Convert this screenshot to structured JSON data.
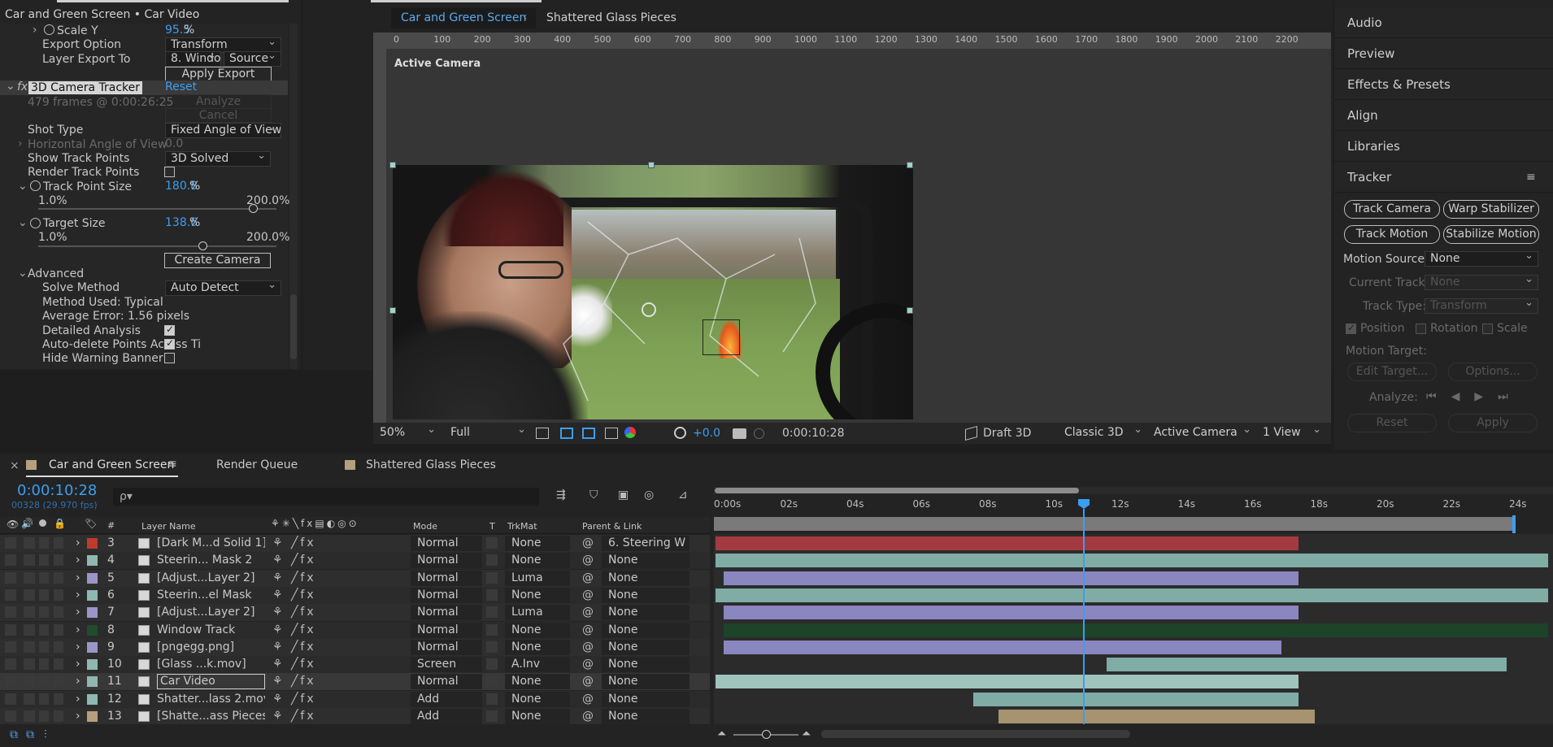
{
  "effect_panel": {
    "title": "Car and Green Screen • Car Video",
    "scale_y_label": "Scale Y",
    "scale_y_value": "95.5",
    "pct": "%",
    "export_option_label": "Export Option",
    "export_option_value": "Transform",
    "layer_export_label": "Layer Export To",
    "layer_export_value": "8. Windo",
    "layer_export_source": "Source",
    "apply_export": "Apply Export",
    "effect_name": "3D Camera Tracker",
    "reset": "Reset",
    "frames_info": "479 frames @ 0:00:26:25",
    "analyze": "Analyze",
    "cancel": "Cancel",
    "shot_type_label": "Shot Type",
    "shot_type_value": "Fixed Angle of View",
    "hav_label": "Horizontal Angle of View",
    "hav_value": "0.0",
    "show_track_label": "Show Track Points",
    "show_track_value": "3D Solved",
    "render_track_label": "Render Track Points",
    "track_size_label": "Track Point Size",
    "track_size_value": "180.8",
    "min1": "1.0%",
    "max1": "200.0%",
    "target_size_label": "Target Size",
    "target_size_value": "138.6",
    "min2": "1.0%",
    "max2": "200.0%",
    "track_size_level": 0.9,
    "target_size_level": 0.69,
    "create_camera": "Create Camera",
    "advanced": "Advanced",
    "solve_method_label": "Solve Method",
    "solve_method_value": "Auto Detect",
    "method_used": "Method Used: Typical",
    "avg_error": "Average Error: 1.56 pixels",
    "detailed": "Detailed Analysis",
    "auto_delete": "Auto-delete Points Across Ti",
    "hide_warning": "Hide Warning Banner"
  },
  "viewer": {
    "tab1": "Car and Green Screen",
    "tab2": "Shattered Glass Pieces",
    "ruler": [
      "0",
      "100",
      "200",
      "300",
      "400",
      "500",
      "600",
      "700",
      "800",
      "900",
      "1000",
      "1100",
      "1200",
      "1300",
      "1400",
      "1500",
      "1600",
      "1700",
      "1800",
      "1900",
      "2000",
      "2100",
      "2200"
    ],
    "active_camera": "Active Camera",
    "zoom": "50%",
    "resolution": "Full",
    "exposure": "+0.0",
    "timecode": "0:00:10:28",
    "draft3d": "Draft 3D",
    "renderer": "Classic 3D",
    "camera": "Active Camera",
    "views": "1 View"
  },
  "right_panel": {
    "tabs": [
      "Audio",
      "Preview",
      "Effects & Presets",
      "Align",
      "Libraries"
    ],
    "tracker_title": "Tracker",
    "track_camera": "Track Camera",
    "warp_stabilizer": "Warp Stabilizer",
    "track_motion": "Track Motion",
    "stabilize_motion": "Stabilize Motion",
    "motion_source_label": "Motion Source:",
    "motion_source_value": "None",
    "current_track_label": "Current Track:",
    "current_track_value": "None",
    "track_type_label": "Track Type:",
    "track_type_value": "Transform",
    "position": "Position",
    "rotation": "Rotation",
    "scale": "Scale",
    "motion_target_label": "Motion Target:",
    "edit_target": "Edit Target...",
    "options": "Options...",
    "analyze": "Analyze:",
    "reset": "Reset",
    "apply": "Apply"
  },
  "timeline": {
    "tab1": "Car and Green Screen",
    "tab2": "Render Queue",
    "tab3": "Shattered Glass Pieces",
    "timecode": "0:00:10:28",
    "fps": "00328 (29.970 fps)",
    "search_placeholder": "ρ▾",
    "col_layer": "Layer Name",
    "col_mode": "Mode",
    "col_t": "T",
    "col_trkmat": "TrkMat",
    "col_parent": "Parent & Link",
    "ruler": [
      "0:00s",
      "02s",
      "04s",
      "06s",
      "08s",
      "10s",
      "12s",
      "14s",
      "16s",
      "18s",
      "20s",
      "22s",
      "24s"
    ],
    "layers": [
      {
        "num": "3",
        "name": "[Dark M...d Solid 1]",
        "mode": "Normal",
        "trk": "None",
        "parent": "6. Steering W",
        "color": "#c0392b",
        "bar": "#a33a3f",
        "bs": 0,
        "be": 0.7
      },
      {
        "num": "4",
        "name": "Steerin... Mask 2",
        "mode": "Normal",
        "trk": "None",
        "parent": "None",
        "color": "#8fb8b0",
        "bar": "#7fada6",
        "bs": 0,
        "be": 1
      },
      {
        "num": "5",
        "name": "[Adjust...Layer 2]",
        "mode": "Normal",
        "trk": "Luma",
        "parent": "None",
        "color": "#9b96c8",
        "bar": "#8a86bf",
        "bs": 0.01,
        "be": 0.7
      },
      {
        "num": "6",
        "name": "Steerin...el Mask",
        "mode": "Normal",
        "trk": "None",
        "parent": "None",
        "color": "#8fb8b0",
        "bar": "#7fada6",
        "bs": 0,
        "be": 1
      },
      {
        "num": "7",
        "name": "[Adjust...Layer 2]",
        "mode": "Normal",
        "trk": "Luma",
        "parent": "None",
        "color": "#9b96c8",
        "bar": "#8a86bf",
        "bs": 0.01,
        "be": 0.7
      },
      {
        "num": "8",
        "name": "Window Track",
        "mode": "Normal",
        "trk": "None",
        "parent": "None",
        "color": "#1f4d2b",
        "bar": "#1d4328",
        "bs": 0.01,
        "be": 1
      },
      {
        "num": "9",
        "name": "[pngegg.png]",
        "mode": "Normal",
        "trk": "None",
        "parent": "None",
        "color": "#9b96c8",
        "bar": "#8a86bf",
        "bs": 0.01,
        "be": 0.68
      },
      {
        "num": "10",
        "name": "[Glass ...k.mov]",
        "mode": "Screen",
        "trk": "A.Inv",
        "parent": "None",
        "color": "#8fb8b0",
        "bar": "#7fada6",
        "bs": 0.47,
        "be": 0.95
      },
      {
        "num": "11",
        "name": "Car Video",
        "mode": "Normal",
        "trk": "None",
        "parent": "None",
        "color": "#8fb8b0",
        "bar": "#9fc4bc",
        "bs": 0,
        "be": 0.7
      },
      {
        "num": "12",
        "name": "Shatter...lass 2.mov",
        "mode": "Add",
        "trk": "None",
        "parent": "None",
        "color": "#8fb8b0",
        "bar": "#7fada6",
        "bs": 0.31,
        "be": 0.7
      },
      {
        "num": "13",
        "name": "[Shatte...ass Pieces]",
        "mode": "Add",
        "trk": "None",
        "parent": "None",
        "color": "#b4a07e",
        "bar": "#a89370",
        "bs": 0.34,
        "be": 0.72
      }
    ]
  }
}
